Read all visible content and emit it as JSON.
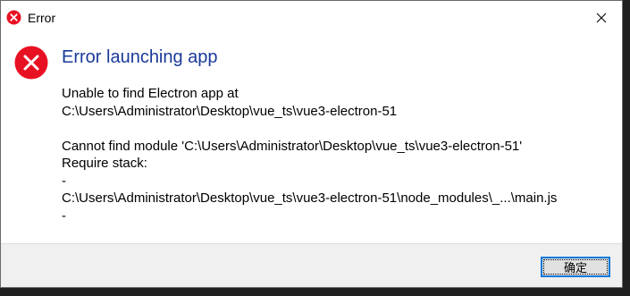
{
  "window": {
    "title": "Error",
    "close_icon": "close-icon",
    "title_icon": "error-icon"
  },
  "dialog": {
    "heading": "Error launching app",
    "icon": "error-icon",
    "message_lines": [
      "Unable to find Electron app at",
      "C:\\Users\\Administrator\\Desktop\\vue_ts\\vue3-electron-51",
      "",
      "Cannot find module 'C:\\Users\\Administrator\\Desktop\\vue_ts\\vue3-electron-51'",
      "Require stack:",
      "-",
      "C:\\Users\\Administrator\\Desktop\\vue_ts\\vue3-electron-51\\node_modules\\_...\\main.js",
      "-"
    ]
  },
  "footer": {
    "ok_label": "确定"
  },
  "colors": {
    "heading": "#1a3a9a",
    "error_red": "#e81123",
    "focus_border": "#0078d7"
  }
}
